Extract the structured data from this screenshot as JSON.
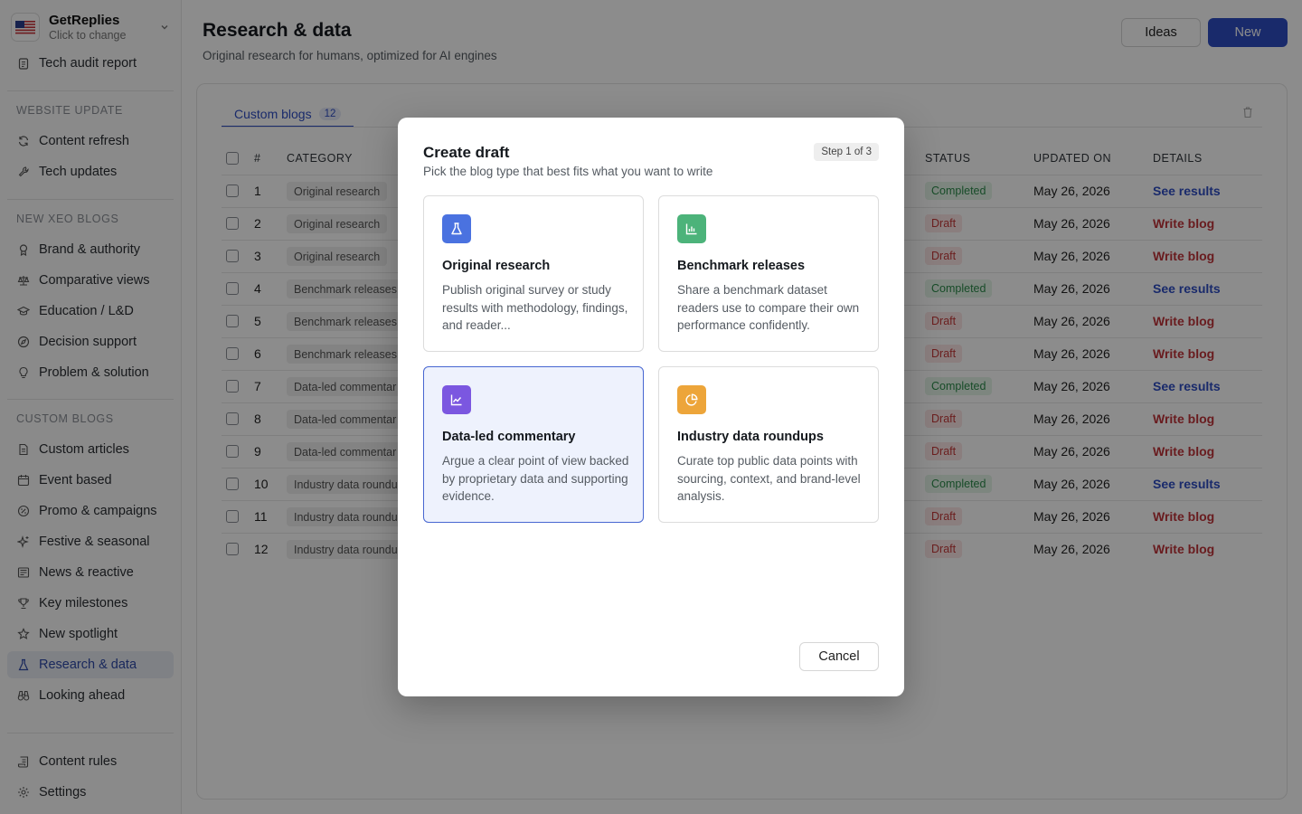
{
  "workspace": {
    "name": "GetReplies",
    "subtitle": "Click to change"
  },
  "sidebar": {
    "top_item": "Tech audit report",
    "sections": [
      {
        "label": "WEBSITE UPDATE",
        "items": [
          "Content refresh",
          "Tech updates"
        ]
      },
      {
        "label": "NEW XEO BLOGS",
        "items": [
          "Brand & authority",
          "Comparative views",
          "Education / L&D",
          "Decision support",
          "Problem & solution"
        ]
      },
      {
        "label": "CUSTOM BLOGS",
        "items": [
          "Custom articles",
          "Event based",
          "Promo & campaigns",
          "Festive & seasonal",
          "News & reactive",
          "Key milestones",
          "New spotlight",
          "Research & data",
          "Looking ahead"
        ]
      }
    ],
    "bottom_items": [
      "Content rules",
      "Settings"
    ],
    "active_item": "Research & data"
  },
  "header": {
    "title": "Research & data",
    "subtitle": "Original research for humans, optimized for AI engines",
    "ideas_label": "Ideas",
    "new_label": "New"
  },
  "tab": {
    "label": "Custom blogs",
    "count": "12"
  },
  "table": {
    "columns": {
      "num": "#",
      "category": "CATEGORY",
      "status": "STATUS",
      "updated": "UPDATED ON",
      "details": "DETAILS"
    },
    "rows": [
      {
        "num": "1",
        "category": "Original research",
        "status": "Completed",
        "date": "May 26, 2026",
        "detail": "See results"
      },
      {
        "num": "2",
        "category": "Original research",
        "status": "Draft",
        "date": "May 26, 2026",
        "detail": "Write blog"
      },
      {
        "num": "3",
        "category": "Original research",
        "status": "Draft",
        "date": "May 26, 2026",
        "detail": "Write blog"
      },
      {
        "num": "4",
        "category": "Benchmark releases",
        "status": "Completed",
        "date": "May 26, 2026",
        "detail": "See results"
      },
      {
        "num": "5",
        "category": "Benchmark releases",
        "status": "Draft",
        "date": "May 26, 2026",
        "detail": "Write blog"
      },
      {
        "num": "6",
        "category": "Benchmark releases",
        "status": "Draft",
        "date": "May 26, 2026",
        "detail": "Write blog"
      },
      {
        "num": "7",
        "category": "Data-led commentar",
        "status": "Completed",
        "date": "May 26, 2026",
        "detail": "See results"
      },
      {
        "num": "8",
        "category": "Data-led commentar",
        "status": "Draft",
        "date": "May 26, 2026",
        "detail": "Write blog"
      },
      {
        "num": "9",
        "category": "Data-led commentar",
        "status": "Draft",
        "date": "May 26, 2026",
        "detail": "Write blog"
      },
      {
        "num": "10",
        "category": "Industry data roundu",
        "status": "Completed",
        "date": "May 26, 2026",
        "detail": "See results"
      },
      {
        "num": "11",
        "category": "Industry data roundu",
        "status": "Draft",
        "date": "May 26, 2026",
        "detail": "Write blog"
      },
      {
        "num": "12",
        "category": "Industry data roundu",
        "status": "Draft",
        "date": "May 26, 2026",
        "detail": "Write blog"
      }
    ]
  },
  "modal": {
    "title": "Create draft",
    "subtitle": "Pick the blog type that best fits what you want to write",
    "step": "Step 1 of 3",
    "cards": [
      {
        "title": "Original research",
        "description": "Publish original survey or study results with methodology, findings, and reader...",
        "icon": "flask-icon",
        "color": "#4a72e0"
      },
      {
        "title": "Benchmark releases",
        "description": "Share a benchmark dataset readers use to compare their own performance confidently.",
        "icon": "bar-chart-icon",
        "color": "#4cb37a"
      },
      {
        "title": "Data-led commentary",
        "description": "Argue a clear point of view backed by proprietary data and supporting evidence.",
        "icon": "line-chart-icon",
        "color": "#7b57e0"
      },
      {
        "title": "Industry data roundups",
        "description": "Curate top public data points with sourcing, context, and brand-level analysis.",
        "icon": "pie-chart-icon",
        "color": "#eda53a"
      }
    ],
    "selected_card": "Data-led commentary",
    "cancel_label": "Cancel"
  },
  "colors": {
    "primary": "#2f4ec4",
    "completed": "#2c8a4a",
    "draft": "#c43a3a"
  }
}
